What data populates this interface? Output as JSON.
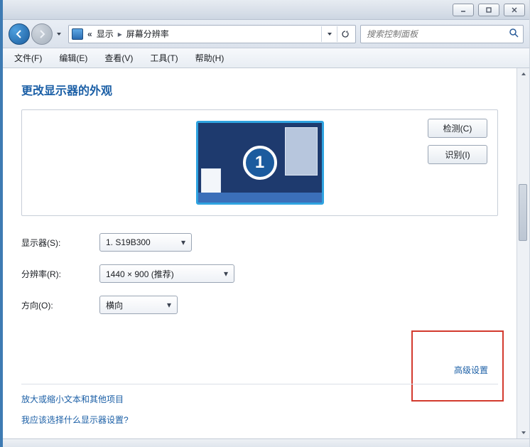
{
  "breadcrumb": {
    "segment1": "显示",
    "segment2": "屏幕分辨率"
  },
  "search": {
    "placeholder": "搜索控制面板"
  },
  "menubar": {
    "file": "文件(F)",
    "edit": "编辑(E)",
    "view": "查看(V)",
    "tools": "工具(T)",
    "help": "帮助(H)"
  },
  "heading": "更改显示器的外观",
  "preview": {
    "monitor_number": "1",
    "detect_button": "检测(C)",
    "identify_button": "识别(I)"
  },
  "form": {
    "display_label": "显示器(S):",
    "display_value": "1. S19B300",
    "resolution_label": "分辨率(R):",
    "resolution_value": "1440 × 900 (推荐)",
    "orientation_label": "方向(O):",
    "orientation_value": "横向"
  },
  "advanced_settings": "高级设置",
  "links": {
    "text_size": "放大或缩小文本和其他项目",
    "which_settings": "我应该选择什么显示器设置?"
  }
}
